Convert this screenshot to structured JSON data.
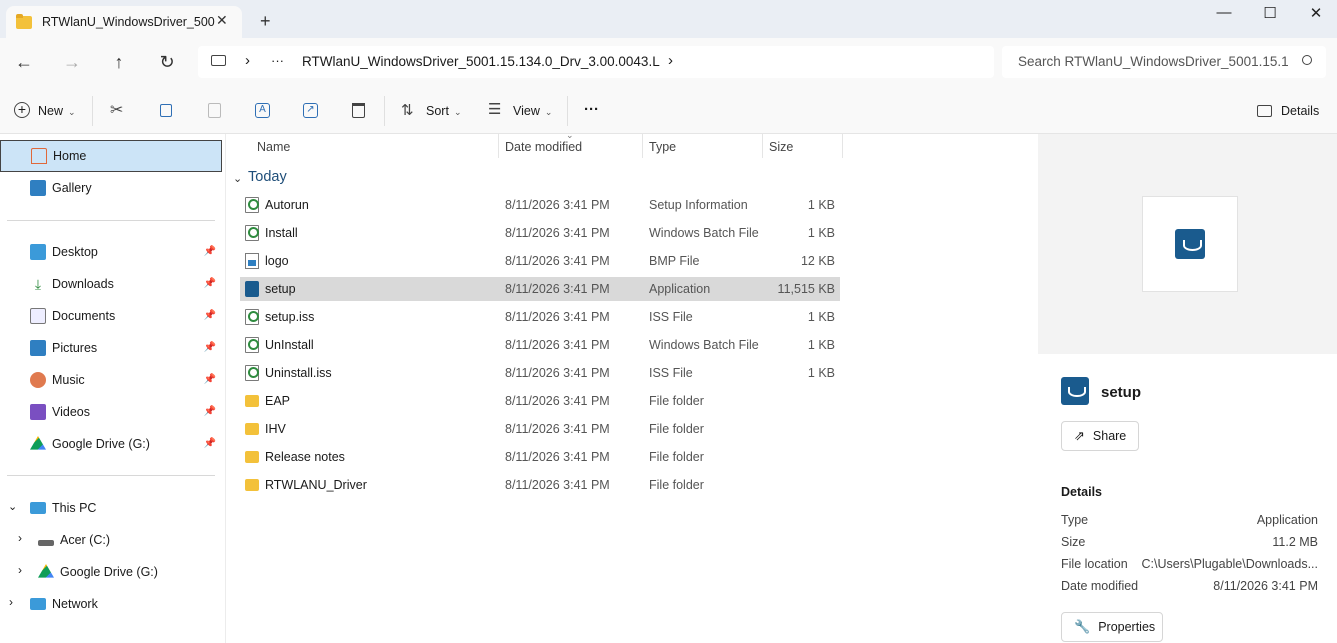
{
  "window": {
    "tab_title": "RTWlanU_WindowsDriver_500",
    "tab_close": "✕",
    "new_tab": "+",
    "minimize": "—",
    "maximize": "☐",
    "close": "✕"
  },
  "navigation": {
    "back": "←",
    "forward": "→",
    "up": "↑",
    "refresh": "↻",
    "breadcrumb_sep": "›",
    "overflow": "···",
    "address_path": "RTWlanU_WindowsDriver_5001.15.134.0_Drv_3.00.0043.L",
    "address_chevron": "›",
    "search_placeholder": "Search RTWlanU_WindowsDriver_5001.15.1"
  },
  "toolbar": {
    "new_label": "New",
    "sort_label": "Sort",
    "view_label": "View",
    "more": "···",
    "details_label": "Details"
  },
  "sidebar": {
    "top_items": [
      {
        "label": "Home",
        "icon": "home-icon",
        "selected": true
      },
      {
        "label": "Gallery",
        "icon": "gallery-icon"
      }
    ],
    "quick_access": [
      {
        "label": "Desktop",
        "icon": "desktop-icon"
      },
      {
        "label": "Downloads",
        "icon": "downloads-icon"
      },
      {
        "label": "Documents",
        "icon": "documents-icon"
      },
      {
        "label": "Pictures",
        "icon": "pictures-icon"
      },
      {
        "label": "Music",
        "icon": "music-icon"
      },
      {
        "label": "Videos",
        "icon": "videos-icon"
      },
      {
        "label": "Google Drive (G:)",
        "icon": "google-drive-icon"
      }
    ],
    "this_pc": "This PC",
    "drives": [
      {
        "label": "Acer (C:)",
        "icon": "drive-icon"
      },
      {
        "label": "Google Drive (G:)",
        "icon": "google-drive-icon"
      }
    ],
    "network": "Network"
  },
  "file_list": {
    "columns": {
      "name": "Name",
      "date": "Date modified",
      "type": "Type",
      "size": "Size"
    },
    "group": "Today",
    "rows": [
      {
        "name": "Autorun",
        "date": "8/11/2026 3:41 PM",
        "type": "Setup Information",
        "size": "1 KB",
        "icon": "doc"
      },
      {
        "name": "Install",
        "date": "8/11/2026 3:41 PM",
        "type": "Windows Batch File",
        "size": "1 KB",
        "icon": "doc"
      },
      {
        "name": "logo",
        "date": "8/11/2026 3:41 PM",
        "type": "BMP File",
        "size": "12 KB",
        "icon": "img"
      },
      {
        "name": "setup",
        "date": "8/11/2026 3:41 PM",
        "type": "Application",
        "size": "11,515 KB",
        "icon": "app",
        "selected": true
      },
      {
        "name": "setup.iss",
        "date": "8/11/2026 3:41 PM",
        "type": "ISS File",
        "size": "1 KB",
        "icon": "doc"
      },
      {
        "name": "UnInstall",
        "date": "8/11/2026 3:41 PM",
        "type": "Windows Batch File",
        "size": "1 KB",
        "icon": "doc"
      },
      {
        "name": "Uninstall.iss",
        "date": "8/11/2026 3:41 PM",
        "type": "ISS File",
        "size": "1 KB",
        "icon": "doc"
      },
      {
        "name": "EAP",
        "date": "8/11/2026 3:41 PM",
        "type": "File folder",
        "size": "",
        "icon": "folder"
      },
      {
        "name": "IHV",
        "date": "8/11/2026 3:41 PM",
        "type": "File folder",
        "size": "",
        "icon": "folder"
      },
      {
        "name": "Release notes",
        "date": "8/11/2026 3:41 PM",
        "type": "File folder",
        "size": "",
        "icon": "folder"
      },
      {
        "name": "RTWLANU_Driver",
        "date": "8/11/2026 3:41 PM",
        "type": "File folder",
        "size": "",
        "icon": "folder"
      }
    ]
  },
  "details": {
    "name": "setup",
    "share_label": "Share",
    "heading": "Details",
    "fields": [
      {
        "key": "Type",
        "value": "Application"
      },
      {
        "key": "Size",
        "value": "11.2 MB"
      },
      {
        "key": "File location",
        "value": "C:\\Users\\Plugable\\Downloads..."
      },
      {
        "key": "Date modified",
        "value": "8/11/2026 3:41 PM"
      }
    ],
    "properties_label": "Properties"
  },
  "colors": {
    "accent": "#1a5b8e",
    "selection": "#cce4f7",
    "row_selected": "#d9d9d9",
    "folder": "#f3c13a"
  }
}
